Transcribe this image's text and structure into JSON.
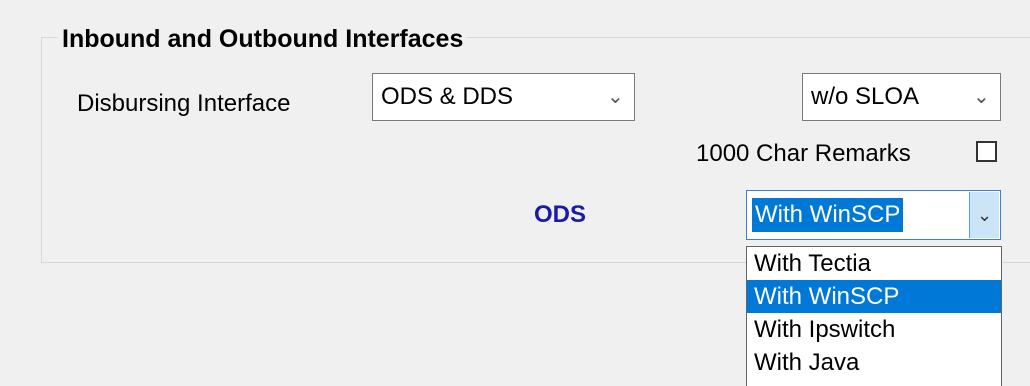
{
  "group": {
    "title": "Inbound and Outbound Interfaces"
  },
  "disbursing": {
    "label": "Disbursing Interface",
    "selected": "ODS & DDS"
  },
  "sloa": {
    "selected": "w/o SLOA"
  },
  "remarks": {
    "label": "1000 Char Remarks",
    "checked": false
  },
  "ods": {
    "label": "ODS",
    "selected": "With WinSCP",
    "options": [
      "With Tectia",
      "With WinSCP",
      "With Ipswitch",
      "With Java"
    ],
    "highlighted_index": 1
  },
  "icons": {
    "chevron": "chevron-down-icon"
  }
}
